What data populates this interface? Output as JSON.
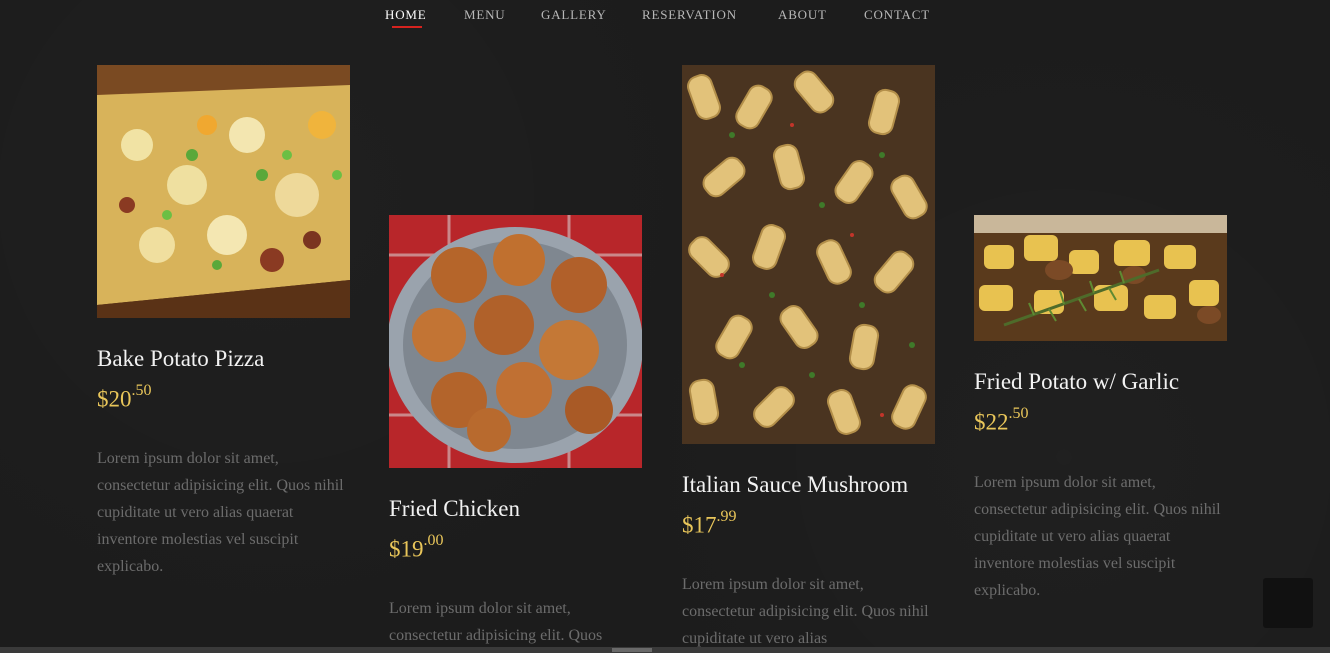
{
  "nav": {
    "items": [
      "HOME",
      "MENU",
      "GALLERY",
      "RESERVATION",
      "ABOUT",
      "CONTACT"
    ],
    "active": "HOME"
  },
  "colors": {
    "background": "#1c1c1c",
    "active_underline": "#d6231f",
    "price": "#e9c65a",
    "description": "#6c6c6c"
  },
  "menu": [
    {
      "name": "Bake Potato Pizza",
      "price_main": "$20",
      "price_cents": ".50",
      "description": "Lorem ipsum dolor sit amet, consectetur adipisicing elit. Quos nihil cupiditate ut vero alias quaerat inventore molestias vel suscipit explicabo."
    },
    {
      "name": "Fried Chicken",
      "price_main": "$19",
      "price_cents": ".00",
      "description": "Lorem ipsum dolor sit amet, consectetur adipisicing elit. Quos"
    },
    {
      "name": "Italian Sauce Mushroom",
      "price_main": "$17",
      "price_cents": ".99",
      "description": "Lorem ipsum dolor sit amet, consectetur adipisicing elit. Quos nihil cupiditate ut vero alias"
    },
    {
      "name": "Fried Potato w/ Garlic",
      "price_main": "$22",
      "price_cents": ".50",
      "description": "Lorem ipsum dolor sit amet, consectetur adipisicing elit. Quos nihil cupiditate ut vero alias quaerat inventore molestias vel suscipit explicabo."
    }
  ]
}
